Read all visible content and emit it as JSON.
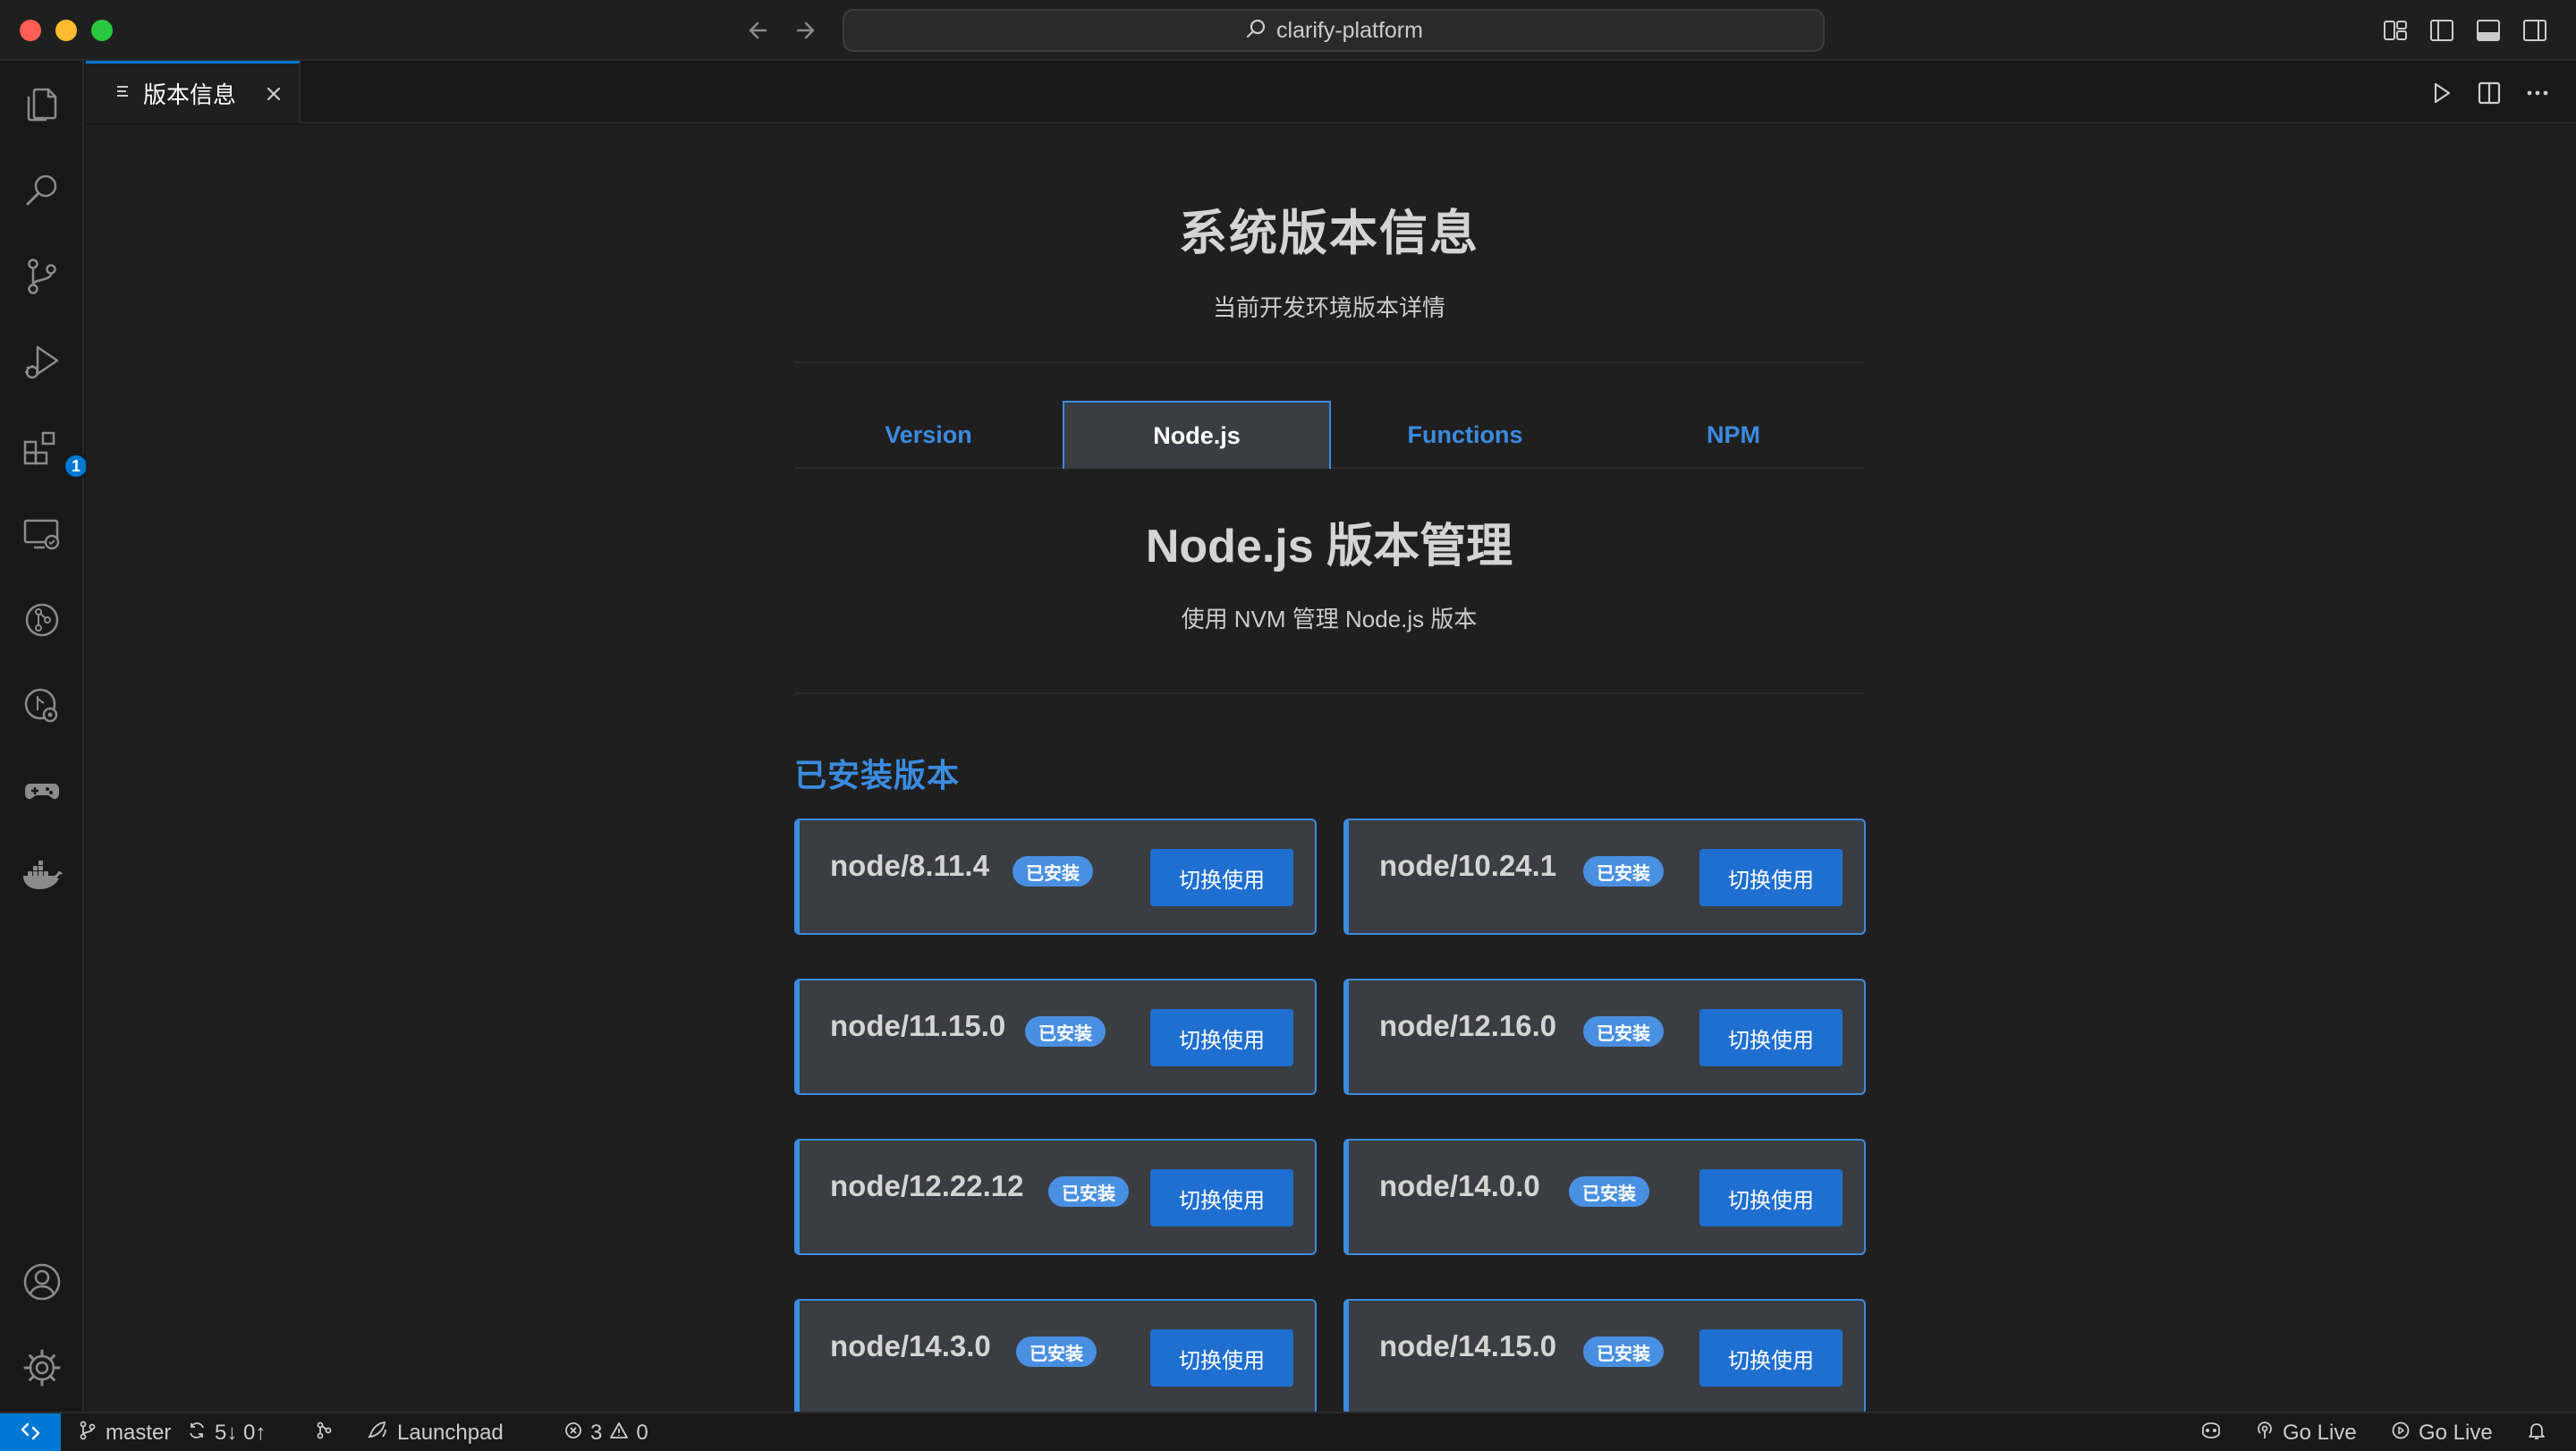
{
  "window": {
    "search_label": "clarify-platform"
  },
  "activity_bar": {
    "items": [
      {
        "name": "explorer",
        "icon": "files-icon"
      },
      {
        "name": "search",
        "icon": "search-icon"
      },
      {
        "name": "source-control",
        "icon": "source-control-icon"
      },
      {
        "name": "run-debug",
        "icon": "run-debug-icon"
      },
      {
        "name": "extensions",
        "icon": "extensions-icon",
        "badge": "1"
      },
      {
        "name": "remote-explorer",
        "icon": "remote-explorer-icon"
      },
      {
        "name": "gitlens",
        "icon": "gitlens-icon"
      },
      {
        "name": "gitlens-inspect",
        "icon": "gitlens-inspect-icon"
      },
      {
        "name": "gamepad",
        "icon": "gamepad-icon"
      },
      {
        "name": "docker",
        "icon": "docker-icon"
      }
    ],
    "bottom": [
      {
        "name": "accounts",
        "icon": "account-icon"
      },
      {
        "name": "manage",
        "icon": "gear-icon"
      }
    ]
  },
  "editor_tab": {
    "label": "版本信息"
  },
  "page": {
    "title": "系统版本信息",
    "subtitle": "当前开发环境版本详情",
    "tabs": [
      {
        "label": "Version",
        "active": false
      },
      {
        "label": "Node.js",
        "active": true
      },
      {
        "label": "Functions",
        "active": false
      },
      {
        "label": "NPM",
        "active": false
      }
    ],
    "section_title": "Node.js 版本管理",
    "section_subtitle": "使用 NVM 管理 Node.js 版本",
    "installed_title": "已安装版本",
    "installed": [
      {
        "version": "node/8.11.4",
        "badge": "已安装",
        "action": "切换使用"
      },
      {
        "version": "node/10.24.1",
        "badge": "已安装",
        "action": "切换使用"
      },
      {
        "version": "node/11.15.0",
        "badge": "已安装",
        "action": "切换使用"
      },
      {
        "version": "node/12.16.0",
        "badge": "已安装",
        "action": "切换使用"
      },
      {
        "version": "node/12.22.12",
        "badge": "已安装",
        "action": "切换使用"
      },
      {
        "version": "node/14.0.0",
        "badge": "已安装",
        "action": "切换使用"
      },
      {
        "version": "node/14.3.0",
        "badge": "已安装",
        "action": "切换使用"
      },
      {
        "version": "node/14.15.0",
        "badge": "已安装",
        "action": "切换使用"
      }
    ]
  },
  "status_bar": {
    "branch": "master",
    "sync": "5↓ 0↑",
    "launchpad": "Launchpad",
    "errors": "3",
    "warnings": "0",
    "go_live_1": "Go Live",
    "go_live_2": "Go Live"
  },
  "colors": {
    "accent": "#3b8be0",
    "button": "#1f6fd1",
    "badge": "#4a90e2",
    "card_bg": "#3a3d41",
    "editor_bg": "#1f1f1f",
    "remote": "#0078d4"
  }
}
